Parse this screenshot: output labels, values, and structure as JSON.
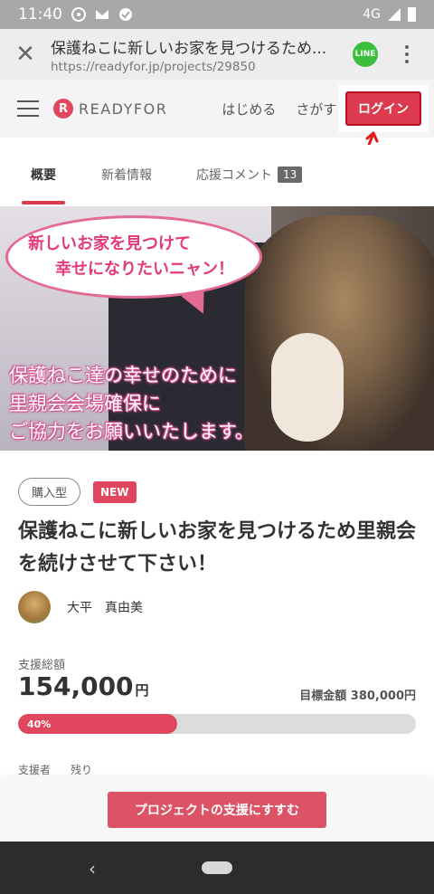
{
  "status_bar": {
    "time": "11:40",
    "network": "4G",
    "icons": [
      "youtube-music-icon",
      "gmail-icon",
      "checkmark-icon"
    ]
  },
  "browser": {
    "title": "保護ねこに新しいお家を見つけるため...",
    "url": "https://readyfor.jp/projects/29850",
    "line_label": "LINE"
  },
  "site_header": {
    "logo_mark": "R",
    "logo_text": "READYFOR",
    "nav_start": "はじめる",
    "nav_search": "さがす",
    "login": "ログイン"
  },
  "tabs": {
    "overview": "概要",
    "news": "新着情報",
    "comments": "応援コメント",
    "comments_count": "13"
  },
  "hero": {
    "speech_line1": "新しいお家を見つけて",
    "speech_line2": "幸せになりたいニャン！",
    "caption_line1": "保護ねこ達の幸せのために",
    "caption_line2": "里親会会場確保に",
    "caption_line3": "ご協力をお願いいたします。"
  },
  "project": {
    "type_tag": "購入型",
    "new_tag": "NEW",
    "title": "保護ねこに新しいお家を見つけるため里親会を続けさせて下さい！",
    "owner_name": "大平　真由美",
    "funding_label": "支援総額",
    "funding_amount": "154,000",
    "funding_unit": "円",
    "goal": "目標金額 380,000円",
    "progress_label": "40%",
    "progress_fraction": 0.4,
    "stats_supporters": "支援者",
    "stats_remaining": "残り"
  },
  "cta": {
    "label": "プロジェクトの支援にすすむ"
  },
  "colors": {
    "accent": "#dc3a4e",
    "hero_text": "#e4397a"
  }
}
